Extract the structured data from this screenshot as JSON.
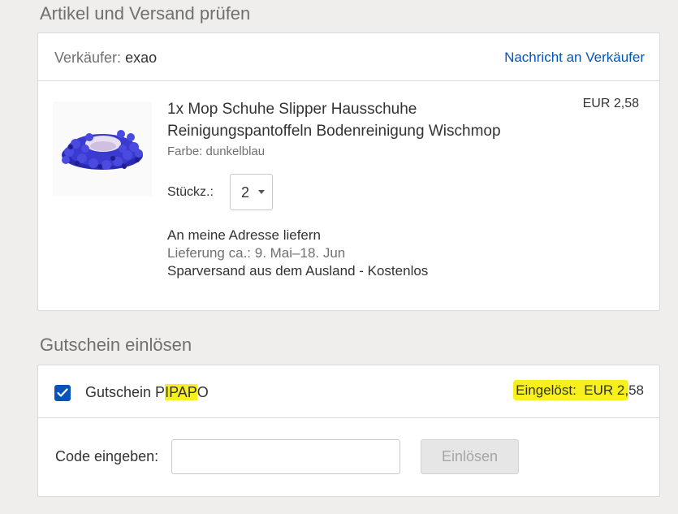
{
  "review_section": {
    "title": "Artikel und Versand prüfen"
  },
  "seller": {
    "label": "Verkäufer:",
    "name": "exao",
    "message_link": "Nachricht an Verkäufer"
  },
  "item": {
    "title_line1": "1x Mop Schuhe Slipper Hausschuhe",
    "title_line2": "Reinigungspantoffeln Bodenreinigung Wischmop",
    "variant": "Farbe: dunkelblau",
    "price": "EUR 2,58",
    "quantity_label": "Stückz.:",
    "quantity_value": "2",
    "image_icon": "mop-slipper-image"
  },
  "shipping": {
    "destination": "An meine Adresse liefern",
    "delivery_estimate": "Lieferung ca.: 9. Mai–18. Jun",
    "method": "Sparversand aus dem Ausland - Kostenlos"
  },
  "coupon_section": {
    "title": "Gutschein einlösen",
    "coupon_prefix": "Gutschein P",
    "coupon_code_highlighted": "IPAP",
    "coupon_suffix": "O",
    "coupon_checked": true,
    "redeemed_label": "Eingelöst:  EUR 2,",
    "redeemed_suffix": "58",
    "code_label": "Code eingeben:",
    "code_value": "",
    "redeem_button": "Einlösen",
    "highlight_color": "#f7f01d",
    "accent_color": "#0654ba"
  }
}
